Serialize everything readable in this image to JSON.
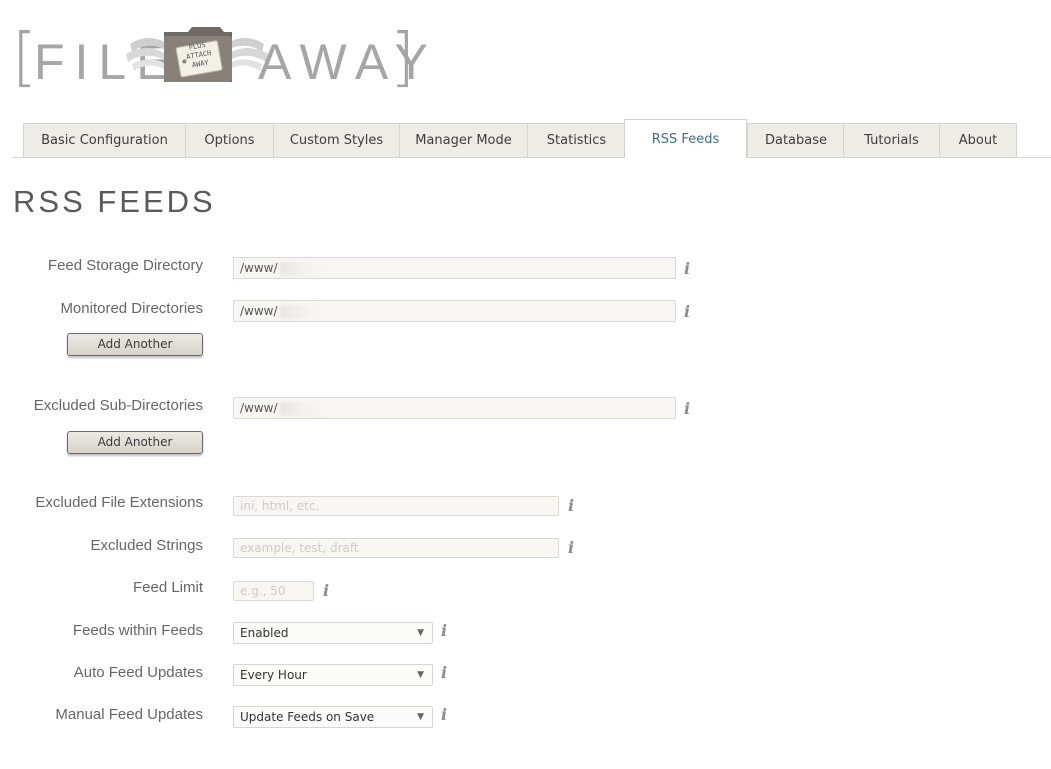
{
  "logo": {
    "word_left": "FILE",
    "word_right": "AWAY",
    "bracket_left": "[",
    "bracket_right": "]",
    "tag_lines": [
      "PLUS",
      "ATTACH",
      "AWAY"
    ]
  },
  "tabs": [
    {
      "label": "Basic Configuration",
      "active": false
    },
    {
      "label": "Options",
      "active": false
    },
    {
      "label": "Custom Styles",
      "active": false
    },
    {
      "label": "Manager Mode",
      "active": false
    },
    {
      "label": "Statistics",
      "active": false
    },
    {
      "label": "RSS Feeds",
      "active": true
    },
    {
      "label": "Database",
      "active": false
    },
    {
      "label": "Tutorials",
      "active": false
    },
    {
      "label": "About",
      "active": false
    }
  ],
  "page": {
    "title": "RSS FEEDS"
  },
  "form": {
    "feed_storage_directory": {
      "label": "Feed Storage Directory",
      "value": "/www/"
    },
    "monitored_directories": {
      "label": "Monitored Directories",
      "value": "/www/"
    },
    "add_another_1": "Add Another",
    "excluded_subdirectories": {
      "label": "Excluded Sub-Directories",
      "value": "/www/"
    },
    "add_another_2": "Add Another",
    "excluded_file_extensions": {
      "label": "Excluded File Extensions",
      "placeholder": "ini, html, etc."
    },
    "excluded_strings": {
      "label": "Excluded Strings",
      "placeholder": "example, test, draft"
    },
    "feed_limit": {
      "label": "Feed Limit",
      "placeholder": "e.g., 50"
    },
    "feeds_within_feeds": {
      "label": "Feeds within Feeds",
      "value": "Enabled"
    },
    "auto_feed_updates": {
      "label": "Auto Feed Updates",
      "value": "Every Hour"
    },
    "manual_feed_updates": {
      "label": "Manual Feed Updates",
      "value": "Update Feeds on Save"
    }
  },
  "icons": {
    "info": "i",
    "dropdown_arrow": "▼"
  },
  "colors": {
    "active_tab_text": "#3f6d8c",
    "tab_bg": "#eeece7",
    "logo_gray": "#a6a6a6"
  }
}
